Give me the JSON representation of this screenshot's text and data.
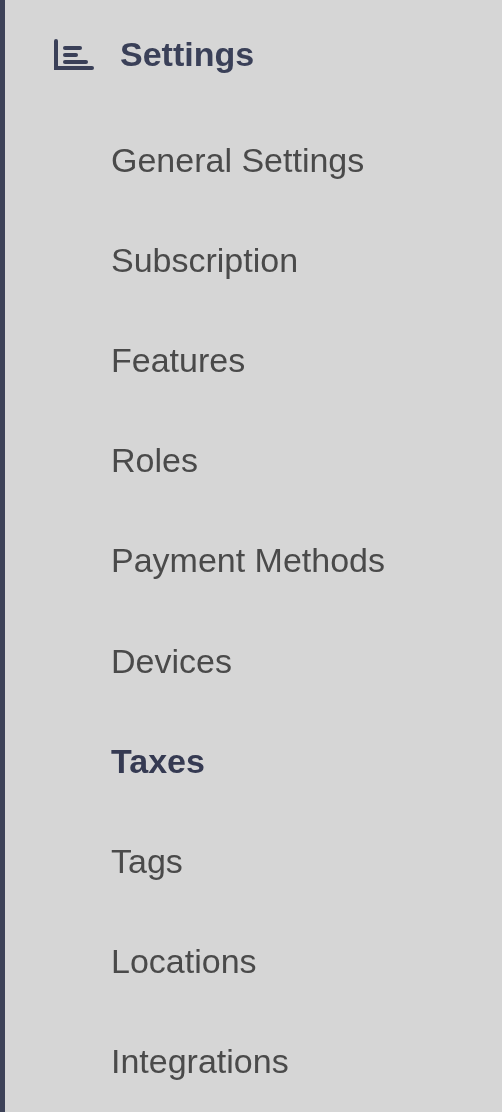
{
  "section": {
    "title": "Settings"
  },
  "items": [
    {
      "label": "General Settings",
      "selected": false
    },
    {
      "label": "Subscription",
      "selected": false
    },
    {
      "label": "Features",
      "selected": false
    },
    {
      "label": "Roles",
      "selected": false
    },
    {
      "label": "Payment Methods",
      "selected": false
    },
    {
      "label": "Devices",
      "selected": false
    },
    {
      "label": "Taxes",
      "selected": true
    },
    {
      "label": "Tags",
      "selected": false
    },
    {
      "label": "Locations",
      "selected": false
    },
    {
      "label": "Integrations",
      "selected": false
    }
  ]
}
